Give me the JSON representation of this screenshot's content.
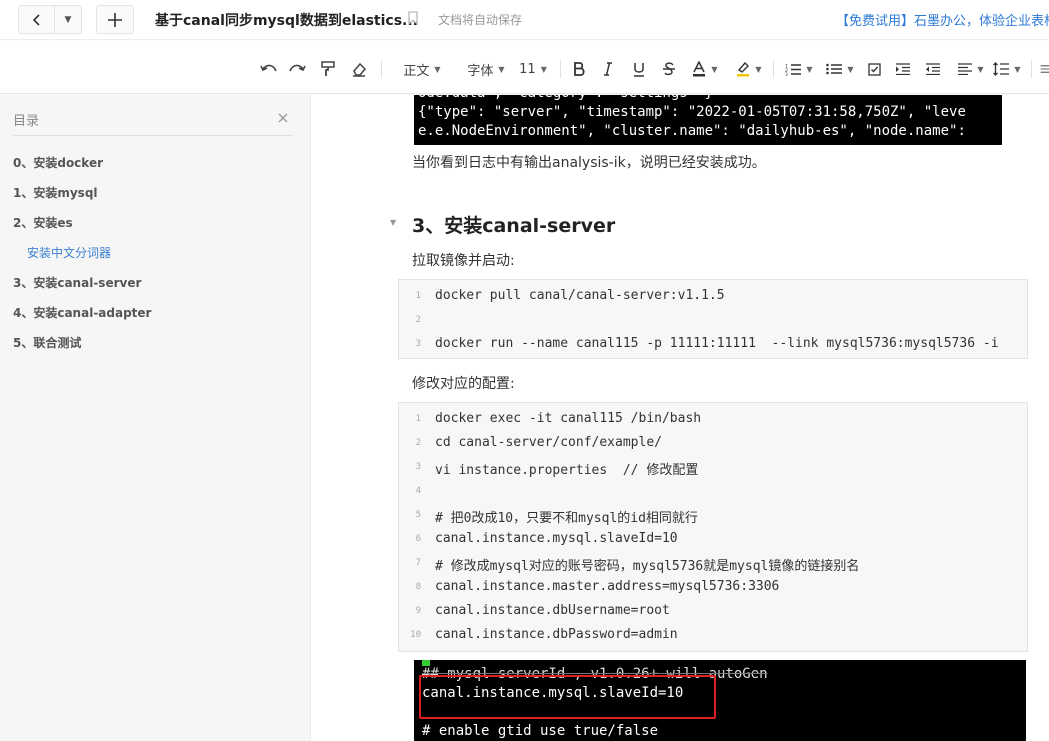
{
  "window": {
    "doc_title": "基于canal同步mysql数据到elastics...",
    "autosave_text": "文档将自动保存",
    "promo_text": "【免费试用】石墨办公，体验企业表格"
  },
  "toolbar": {
    "style_label": "正文",
    "font_label": "字体",
    "size_label": "11"
  },
  "toc": {
    "title": "目录",
    "items": [
      {
        "label": "0、安装docker"
      },
      {
        "label": "1、安装mysql"
      },
      {
        "label": "2、安装es"
      },
      {
        "label": "安装中文分词器"
      },
      {
        "label": "3、安装canal-server"
      },
      {
        "label": "4、安装canal-adapter"
      },
      {
        "label": "5、联合测试"
      }
    ],
    "active_color": "#3a80d2"
  },
  "content": {
    "term1_lines": [
      "ode.data\", \"category\": \"settings\" }",
      "{\"type\": \"server\", \"timestamp\": \"2022-01-05T07:31:58,750Z\", \"leve",
      "e.e.NodeEnvironment\", \"cluster.name\": \"dailyhub-es\", \"node.name\": "
    ],
    "success_text": "当你看到日志中有输出analysis-ik，说明已经安装成功。",
    "heading": "3、安装canal-server",
    "pull_text": "拉取镜像并启动:",
    "code1": [
      {
        "n": "1",
        "text": "docker pull canal/canal-server:v1.1.5"
      },
      {
        "n": "2",
        "text": ""
      },
      {
        "n": "3",
        "text": "docker run --name canal115 -p 11111:11111  --link mysql5736:mysql5736 -i"
      }
    ],
    "modify_text": "修改对应的配置:",
    "code2": [
      {
        "n": "1",
        "text": "docker exec -it canal115 /bin/bash"
      },
      {
        "n": "2",
        "text": "cd canal-server/conf/example/"
      },
      {
        "n": "3",
        "text": "vi instance.properties  // 修改配置"
      },
      {
        "n": "4",
        "text": ""
      },
      {
        "n": "5",
        "text": "# 把0改成10，只要不和mysql的id相同就行"
      },
      {
        "n": "6",
        "text": "canal.instance.mysql.slaveId=10"
      },
      {
        "n": "7",
        "text": "# 修改成mysql对应的账号密码，mysql5736就是mysql镜像的链接别名"
      },
      {
        "n": "8",
        "text": "canal.instance.master.address=mysql5736:3306"
      },
      {
        "n": "9",
        "text": "canal.instance.dbUsername=root"
      },
      {
        "n": "10",
        "text": "canal.instance.dbPassword=admin"
      }
    ],
    "term2_lines": [
      "## mysql serverId , v1.0.26+ will autoGen",
      "canal.instance.mysql.slaveId=10",
      "",
      "# enable gtid use true/false"
    ],
    "highlight_color": "#e02020"
  }
}
